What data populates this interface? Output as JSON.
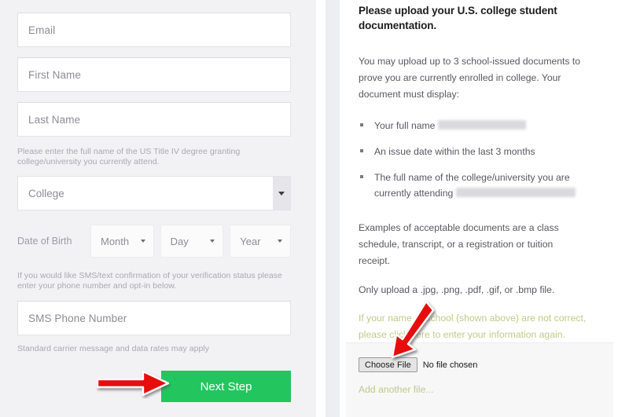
{
  "left_form": {
    "fields": [
      {
        "name": "email",
        "placeholder": "Email"
      },
      {
        "name": "first_name",
        "placeholder": "First Name"
      },
      {
        "name": "last_name",
        "placeholder": "Last Name"
      }
    ],
    "college_helper": "Please enter the full name of the US Title IV degree granting college/university you currently attend.",
    "college_select": {
      "placeholder": "College",
      "caret": "chevron-down-icon"
    },
    "dob": {
      "label": "Date of Birth",
      "month_placeholder": "Month",
      "day_placeholder": "Day",
      "year_placeholder": "Year"
    },
    "sms_helper": "If you would like SMS/text confirmation of your verification status please enter your phone number and opt-in below.",
    "sms_field_placeholder": "SMS Phone Number",
    "carrier_note": "Standard carrier message and data rates may apply",
    "next_step_label": "Next Step",
    "next_step_color": "#22c55e"
  },
  "right_panel": {
    "heading": "Please upload your U.S. college student documentation.",
    "intro": "You may upload up to 3 school-issued documents to prove you are currently enrolled in college. Your document must display:",
    "requirements": [
      {
        "text_before": "Your full name",
        "redacted": true,
        "redact_width": 110,
        "text_after": ""
      },
      {
        "text_before": "An issue date within the last 3 months",
        "redacted": false,
        "redact_width": 0,
        "text_after": ""
      },
      {
        "text_before": "The full name of the college/university you are currently attending",
        "redacted": true,
        "redact_width": 150,
        "text_after": ""
      }
    ],
    "examples": "Examples of acceptable documents are a class schedule, transcript, or a registration or tuition receipt.",
    "file_types": "Only upload a .jpg, .png, .pdf, .gif, or .bmp file.",
    "correction_link": "If your name or school (shown above) are not correct, please click here to enter your information again.",
    "link_color": "#c2c98a",
    "choose_file_label": "Choose File",
    "no_file_text": "No file chosen",
    "add_another_label": "Add another file..."
  },
  "annotations": {
    "arrow_color": "#e8110e",
    "left_arrow_target": "next-step-button",
    "right_arrow_target": "choose-file-button"
  }
}
